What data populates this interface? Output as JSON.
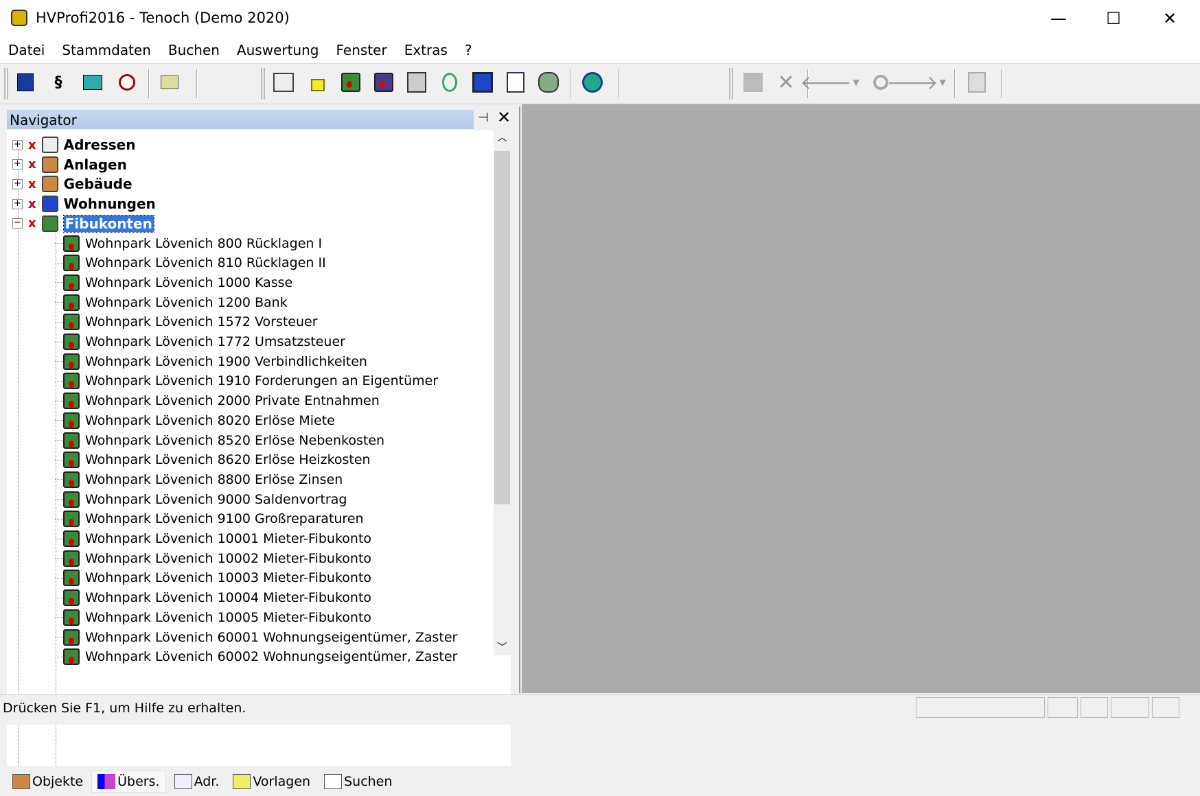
{
  "window": {
    "title": "HVProfi2016 - Tenoch (Demo 2020)",
    "minimize": "—",
    "maximize": "☐",
    "close": "✕"
  },
  "menu": [
    "Datei",
    "Stammdaten",
    "Buchen",
    "Auswertung",
    "Fenster",
    "Extras",
    "?"
  ],
  "toolbar": {
    "section_sign": "§",
    "back": "🡐",
    "forward": "🡒",
    "delete": "✕"
  },
  "navigator": {
    "title": "Navigator",
    "pin": "⊣",
    "close": "✕",
    "groups": [
      {
        "label": "Adressen",
        "expanded": false
      },
      {
        "label": "Anlagen",
        "expanded": false
      },
      {
        "label": "Gebäude",
        "expanded": false
      },
      {
        "label": "Wohnungen",
        "expanded": false
      },
      {
        "label": "Fibukonten",
        "expanded": true,
        "selected": true
      }
    ],
    "items": [
      "Wohnpark Lövenich 800 Rücklagen I",
      "Wohnpark Lövenich 810 Rücklagen II",
      "Wohnpark Lövenich 1000 Kasse",
      "Wohnpark Lövenich 1200 Bank",
      "Wohnpark Lövenich 1572 Vorsteuer",
      "Wohnpark Lövenich 1772 Umsatzsteuer",
      "Wohnpark Lövenich 1900 Verbindlichkeiten",
      "Wohnpark Lövenich 1910 Forderungen an Eigentümer",
      "Wohnpark Lövenich 2000 Private Entnahmen",
      "Wohnpark Lövenich 8020 Erlöse Miete",
      "Wohnpark Lövenich 8520 Erlöse Nebenkosten",
      "Wohnpark Lövenich 8620 Erlöse Heizkosten",
      "Wohnpark Lövenich 8800 Erlöse Zinsen",
      "Wohnpark Lövenich 9000 Saldenvortrag",
      "Wohnpark Lövenich 9100 Großreparaturen",
      "Wohnpark Lövenich 10001 Mieter-Fibukonto",
      "Wohnpark Lövenich 10002 Mieter-Fibukonto",
      "Wohnpark Lövenich 10003 Mieter-Fibukonto",
      "Wohnpark Lövenich 10004 Mieter-Fibukonto",
      "Wohnpark Lövenich 10005 Mieter-Fibukonto",
      "Wohnpark Lövenich 60001 Wohnungseigentümer, Zaster",
      "Wohnpark Lövenich 60002 Wohnungseigentümer, Zaster"
    ],
    "tabs": [
      {
        "label": "Objekte"
      },
      {
        "label": "Übers.",
        "active": true
      },
      {
        "label": "Adr."
      },
      {
        "label": "Vorlagen"
      },
      {
        "label": "Suchen"
      }
    ]
  },
  "status": {
    "text": "Drücken Sie F1, um Hilfe zu erhalten."
  }
}
